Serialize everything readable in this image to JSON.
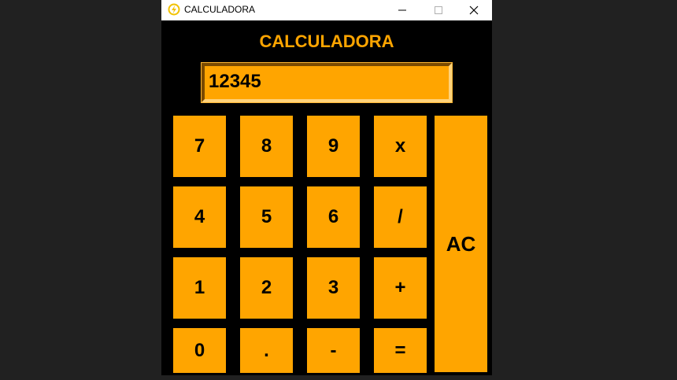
{
  "window": {
    "title": "CALCULADORA",
    "icon": "lightning-bolt-circle-icon",
    "controls": [
      "minimize-icon",
      "maximize-icon",
      "close-icon"
    ]
  },
  "app": {
    "heading": "CALCULADORA",
    "display_value": "12345"
  },
  "keys": {
    "k7": "7",
    "k8": "8",
    "k9": "9",
    "mul": "x",
    "k4": "4",
    "k5": "5",
    "k6": "6",
    "div": "/",
    "k1": "1",
    "k2": "2",
    "k3": "3",
    "add": "+",
    "k0": "0",
    "dot": ".",
    "sub": "-",
    "eq": "=",
    "ac": "AC"
  },
  "colors": {
    "accent": "#ffa500",
    "background": "#000000",
    "desktop": "#212121"
  }
}
